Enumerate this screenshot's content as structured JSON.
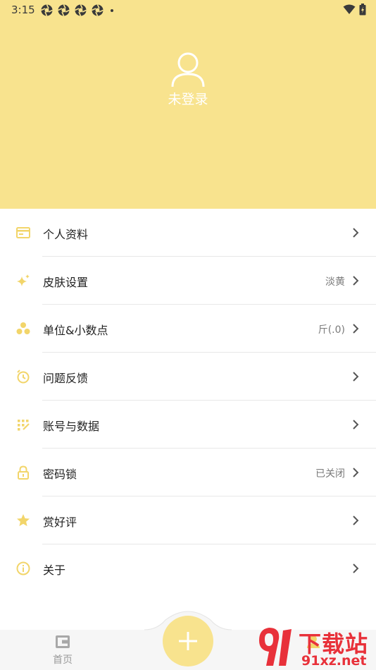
{
  "status_bar": {
    "time": "3:15"
  },
  "header": {
    "login_text": "未登录"
  },
  "menu": [
    {
      "label": "个人资料",
      "value": "",
      "icon": "id-card-icon"
    },
    {
      "label": "皮肤设置",
      "value": "淡黄",
      "icon": "sparkle-icon"
    },
    {
      "label": "单位&小数点",
      "value": "斤(.0)",
      "icon": "dots-icon"
    },
    {
      "label": "问题反馈",
      "value": "",
      "icon": "feedback-icon"
    },
    {
      "label": "账号与数据",
      "value": "",
      "icon": "data-grid-icon"
    },
    {
      "label": "密码锁",
      "value": "已关闭",
      "icon": "lock-icon"
    },
    {
      "label": "赏好评",
      "value": "",
      "icon": "star-icon"
    },
    {
      "label": "关于",
      "value": "",
      "icon": "info-icon"
    }
  ],
  "bottom_nav": {
    "home_label": "首页"
  },
  "watermark": {
    "title": "下载站",
    "url": "91xz.net"
  },
  "colors": {
    "accent": "#f8e38e",
    "icon": "#f2d56a",
    "watermark": "#e8313a"
  }
}
